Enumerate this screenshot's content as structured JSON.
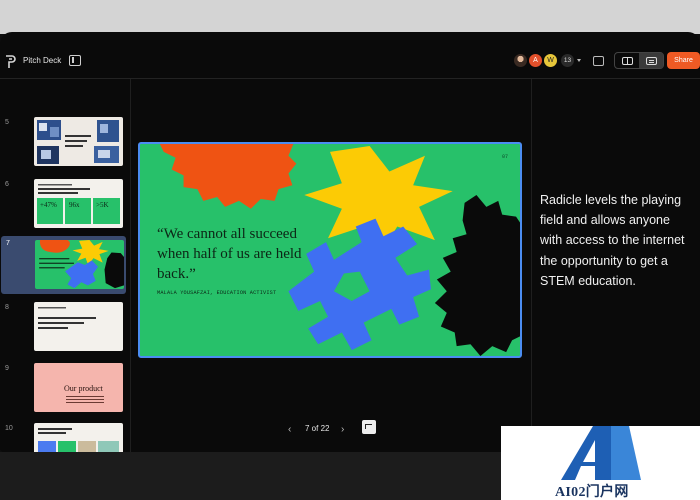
{
  "toolbar": {
    "doc_title": "Pitch Deck",
    "collaborators": [
      "A",
      "W"
    ],
    "collaborator_count": "13",
    "share_label": "Share",
    "accent_color": "#ef5a24"
  },
  "slides": [
    {
      "number": "5"
    },
    {
      "number": "6",
      "stats": [
        "+47%",
        "96x",
        ">5K"
      ]
    },
    {
      "number": "7",
      "selected": true
    },
    {
      "number": "8"
    },
    {
      "number": "9",
      "title": "Our product"
    },
    {
      "number": "10"
    }
  ],
  "current_slide": {
    "page_number": "07",
    "quote": "“We cannot all succeed when half of us are held back.”",
    "attribution": "MALALA YOUSAFZAI, EDUCATION ACTIVIST",
    "background_color": "#27c16a"
  },
  "pager": {
    "label": "7 of 22",
    "prev_icon": "chevron-left-icon",
    "next_icon": "chevron-right-icon"
  },
  "notes": {
    "text": "Radicle levels the playing field and allows anyone with access to the internet the opportunity to get a STEM education."
  },
  "watermark": {
    "text": "AI02门户网"
  }
}
